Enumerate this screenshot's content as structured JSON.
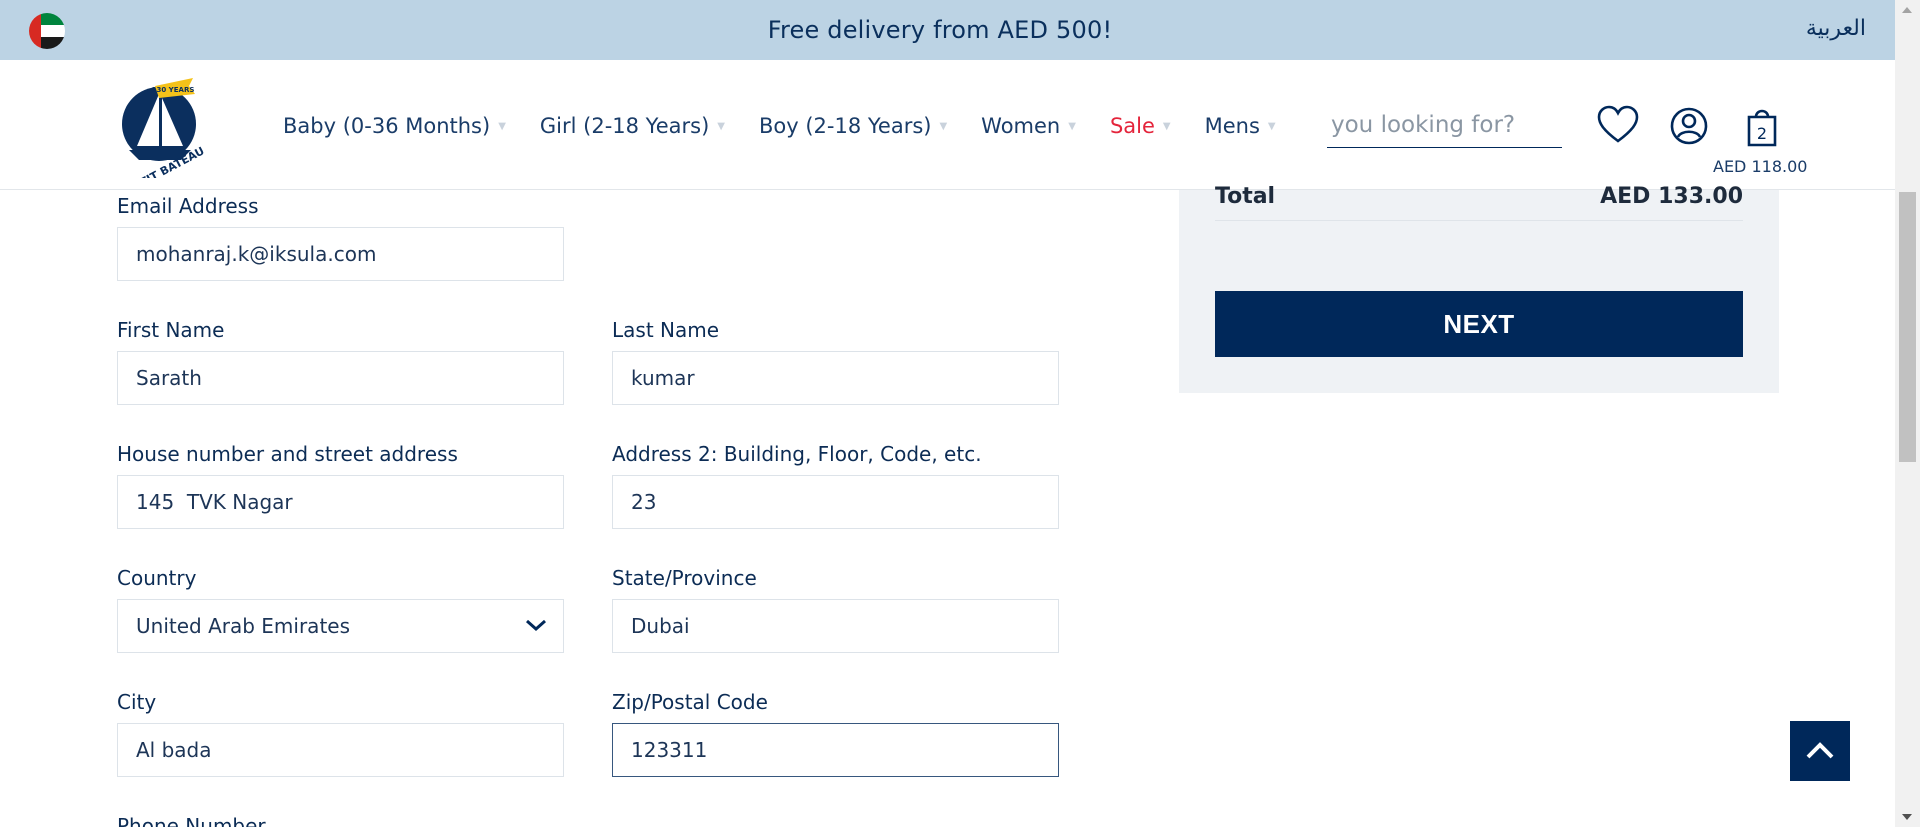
{
  "promo": {
    "message": "Free delivery from AED 500!",
    "language_link": "العربية",
    "flag_icon": "uae-flag-icon"
  },
  "header": {
    "logo_text": "PETIT BATEAU",
    "logo_badge": "130 YEARS",
    "nav": [
      {
        "label": "Baby (0-36 Months)",
        "has_dropdown": true
      },
      {
        "label": "Girl (2-18 Years)",
        "has_dropdown": true
      },
      {
        "label": "Boy (2-18 Years)",
        "has_dropdown": true
      },
      {
        "label": "Women",
        "has_dropdown": true
      },
      {
        "label": "Sale",
        "has_dropdown": true
      },
      {
        "label": "Mens",
        "has_dropdown": true
      }
    ],
    "search_placeholder": "you looking for?",
    "cart_count": "2",
    "cart_total": "AED 118.00",
    "icons": [
      "heart-icon",
      "user-account-icon",
      "shopping-bag-icon"
    ]
  },
  "form": {
    "email": {
      "label": "Email Address",
      "value": "mohanraj.k@iksula.com"
    },
    "first_name": {
      "label": "First Name",
      "value": "Sarath"
    },
    "last_name": {
      "label": "Last Name",
      "value": "kumar"
    },
    "address1": {
      "label": "House number and street address",
      "value": "145  TVK Nagar"
    },
    "address2": {
      "label": "Address 2: Building, Floor, Code, etc.",
      "value": "23"
    },
    "country": {
      "label": "Country",
      "value": "United Arab Emirates"
    },
    "state": {
      "label": "State/Province",
      "value": "Dubai"
    },
    "city": {
      "label": "City",
      "value": "Al bada"
    },
    "zip": {
      "label": "Zip/Postal Code",
      "value": "123311"
    },
    "phone": {
      "label": "Phone Number"
    }
  },
  "summary": {
    "total_label": "Total",
    "total_value": "AED 133.00",
    "next_label": "NEXT"
  },
  "colors": {
    "navy": "#00285a",
    "promo_bg": "#bcd3e4",
    "sale_red": "#e4243b",
    "summary_bg": "#eff2f5"
  }
}
